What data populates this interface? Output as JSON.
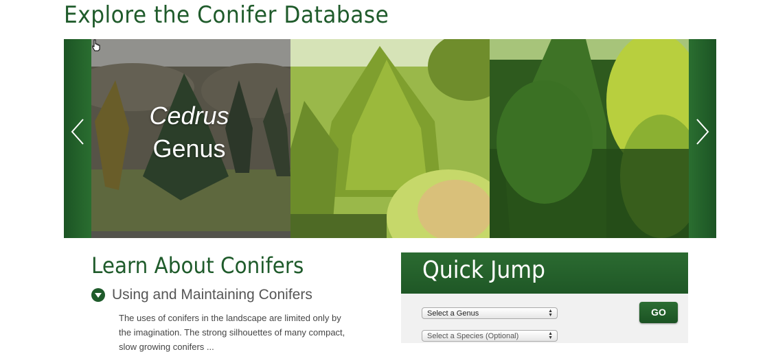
{
  "page": {
    "title": "Explore the Conifer Database"
  },
  "carousel": {
    "prev_icon": "chevron-left-icon",
    "next_icon": "chevron-right-icon",
    "slides": [
      {
        "genus": "Cedrus",
        "label": "Genus"
      },
      {
        "genus": "",
        "label": ""
      },
      {
        "genus": "",
        "label": ""
      }
    ]
  },
  "learn": {
    "title": "Learn About Conifers",
    "item": {
      "label": "Using and Maintaining Conifers",
      "icon": "chevron-down-circle-icon"
    },
    "text": "The uses of conifers in the landscape are limited only by the imagination. The strong silhouettes of many compact, slow growing conifers ..."
  },
  "quick_jump": {
    "title": "Quick Jump",
    "genus_select": "Select a Genus",
    "species_select": "Select a Species (Optional)",
    "go_label": "GO"
  },
  "colors": {
    "brand_green": "#1f5b2b",
    "panel_bg": "#f1f1f1"
  }
}
